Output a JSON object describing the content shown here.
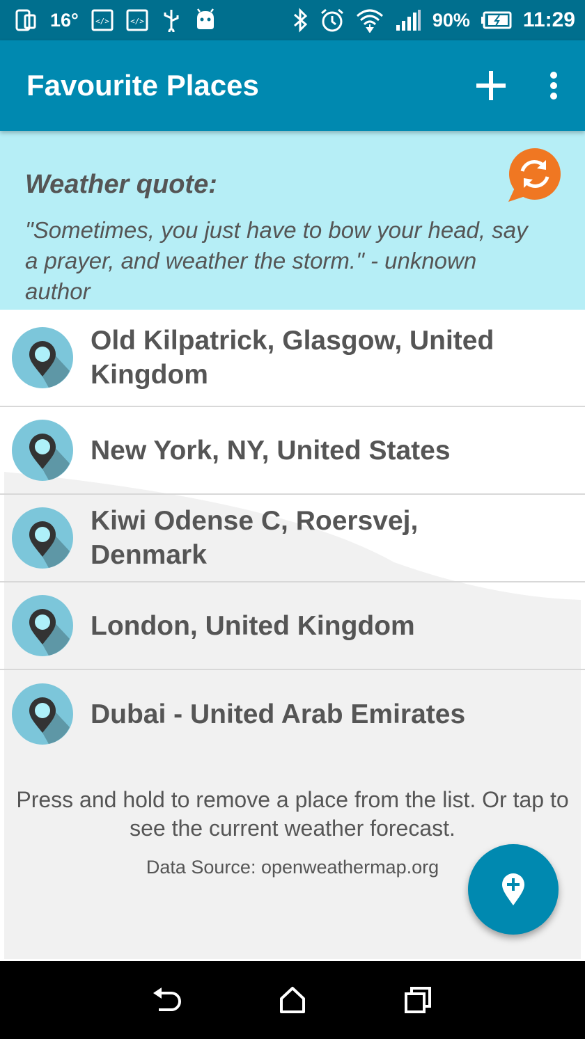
{
  "status_bar": {
    "temperature": "16°",
    "battery": "90%",
    "time": "11:29"
  },
  "app_bar": {
    "title": "Favourite Places",
    "add_icon": "plus-icon",
    "more_icon": "overflow-menu-icon"
  },
  "quote": {
    "title": "Weather quote:",
    "text": "\"Sometimes, you just have to bow your head, say a prayer, and weather the storm.\" - unknown author",
    "refresh_icon": "refresh-icon"
  },
  "places": [
    {
      "label": "Old Kilpatrick, Glasgow, United Kingdom"
    },
    {
      "label": "New York, NY, United States"
    },
    {
      "label": "Kiwi Odense C, Roersvej, Denmark"
    },
    {
      "label": "London, United Kingdom"
    },
    {
      "label": "Dubai - United Arab Emirates"
    }
  ],
  "hint": "Press and hold to remove a place from the list. Or tap to see the current weather forecast.",
  "data_source": "Data Source: openweathermap.org",
  "fab_icon": "add-location-icon",
  "colors": {
    "status_bar": "#006f8e",
    "app_bar": "#0089b0",
    "quote_bg": "#b6eef6",
    "refresh": "#f07722"
  }
}
